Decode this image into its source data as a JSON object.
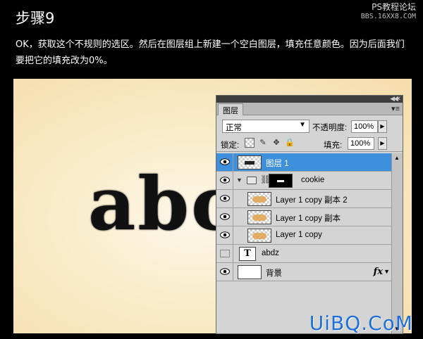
{
  "header": {
    "step_title": "步骤9",
    "site_name": "PS教程论坛",
    "site_url": "BBS.16XX8.COM",
    "description": "OK，获取这个不规则的选区。然后在图层组上新建一个空白图层，填充任意颜色。因为后面我们要把它的填充改为0%。"
  },
  "canvas": {
    "text": "abc"
  },
  "layers_panel": {
    "tab_label": "图层",
    "blend_mode": "正常",
    "opacity_label": "不透明度:",
    "opacity_value": "100%",
    "lock_label": "锁定:",
    "fill_label": "填充:",
    "fill_value": "100%",
    "layers": [
      {
        "name": "图层 1",
        "selected": true,
        "visible": true
      },
      {
        "name": "cookie",
        "type": "group",
        "visible": true
      },
      {
        "name": "Layer 1 copy 副本 2",
        "visible": true
      },
      {
        "name": "Layer 1 copy 副本",
        "visible": true
      },
      {
        "name": "Layer 1 copy",
        "visible": true
      },
      {
        "name": "abdz",
        "type": "text",
        "visible": false
      },
      {
        "name": "背景",
        "visible": true,
        "fx": "fx"
      }
    ]
  },
  "watermark": "UiBQ.CoM",
  "colors": {
    "selected_layer": "#3e8fdc",
    "watermark": "#1e6fd9",
    "canvas_bg": "#f9e9c3"
  }
}
